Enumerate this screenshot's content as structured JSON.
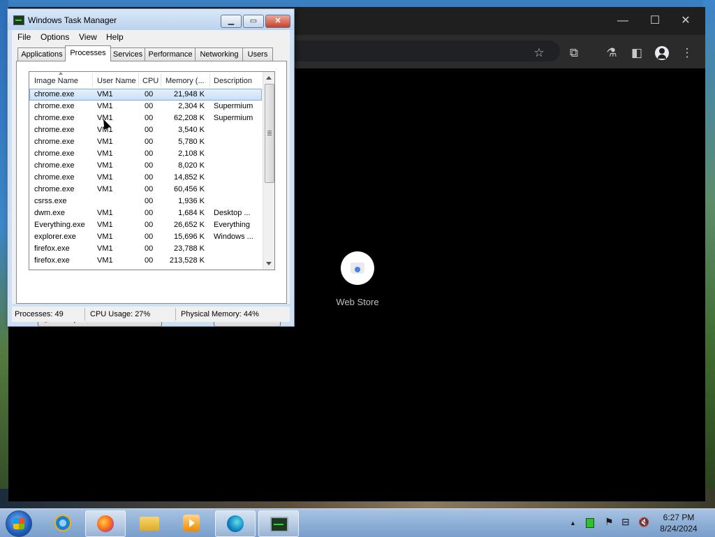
{
  "chrome": {
    "web_store_label": "Web Store",
    "controls": {
      "minimize": "—",
      "maximize": "☐",
      "close": "✕"
    },
    "toolbar_icons": [
      "star-icon",
      "extensions-icon",
      "labs-icon",
      "sidepanel-icon",
      "profile-icon",
      "menu-icon"
    ]
  },
  "task_manager": {
    "title": "Windows Task Manager",
    "window_buttons": {
      "minimize": "▁",
      "maximize": "▭",
      "close": "✕"
    },
    "menu": {
      "file": "File",
      "options": "Options",
      "view": "View",
      "help": "Help"
    },
    "tabs": [
      {
        "label": "Applications"
      },
      {
        "label": "Processes"
      },
      {
        "label": "Services"
      },
      {
        "label": "Performance"
      },
      {
        "label": "Networking"
      },
      {
        "label": "Users"
      }
    ],
    "columns": {
      "image_name": "Image Name",
      "user_name": "User Name",
      "cpu": "CPU",
      "memory": "Memory (...",
      "description": "Description"
    },
    "rows": [
      {
        "name": "chrome.exe",
        "user": "VM1",
        "cpu": "00",
        "memory": "21,948 K",
        "description": ""
      },
      {
        "name": "chrome.exe",
        "user": "VM1",
        "cpu": "00",
        "memory": "2,304 K",
        "description": "Supermium"
      },
      {
        "name": "chrome.exe",
        "user": "VM1",
        "cpu": "00",
        "memory": "62,208 K",
        "description": "Supermium"
      },
      {
        "name": "chrome.exe",
        "user": "VM1",
        "cpu": "00",
        "memory": "3,540 K",
        "description": ""
      },
      {
        "name": "chrome.exe",
        "user": "VM1",
        "cpu": "00",
        "memory": "5,780 K",
        "description": ""
      },
      {
        "name": "chrome.exe",
        "user": "VM1",
        "cpu": "00",
        "memory": "2,108 K",
        "description": ""
      },
      {
        "name": "chrome.exe",
        "user": "VM1",
        "cpu": "00",
        "memory": "8,020 K",
        "description": ""
      },
      {
        "name": "chrome.exe",
        "user": "VM1",
        "cpu": "00",
        "memory": "14,852 K",
        "description": ""
      },
      {
        "name": "chrome.exe",
        "user": "VM1",
        "cpu": "00",
        "memory": "60,456 K",
        "description": ""
      },
      {
        "name": "csrss.exe",
        "user": "",
        "cpu": "00",
        "memory": "1,936 K",
        "description": ""
      },
      {
        "name": "dwm.exe",
        "user": "VM1",
        "cpu": "00",
        "memory": "1,684 K",
        "description": "Desktop ..."
      },
      {
        "name": "Everything.exe",
        "user": "VM1",
        "cpu": "00",
        "memory": "26,652 K",
        "description": "Everything"
      },
      {
        "name": "explorer.exe",
        "user": "VM1",
        "cpu": "00",
        "memory": "15,696 K",
        "description": "Windows ..."
      },
      {
        "name": "firefox.exe",
        "user": "VM1",
        "cpu": "00",
        "memory": "23,788 K",
        "description": ""
      },
      {
        "name": "firefox.exe",
        "user": "VM1",
        "cpu": "00",
        "memory": "213,528 K",
        "description": ""
      }
    ],
    "show_all_button": "Show processes from all users",
    "end_process_button": "End Process",
    "status": {
      "processes": "Processes: 49",
      "cpu": "CPU Usage: 27%",
      "memory": "Physical Memory: 44%"
    }
  },
  "taskbar": {
    "apps": [
      {
        "name": "internet-explorer-icon",
        "open": false
      },
      {
        "name": "firefox-icon",
        "open": true
      },
      {
        "name": "file-explorer-icon",
        "open": false
      },
      {
        "name": "media-player-icon",
        "open": false
      },
      {
        "name": "supermium-icon",
        "open": true
      },
      {
        "name": "task-manager-icon",
        "open": true
      }
    ],
    "tray": {
      "show_hidden": "▲",
      "flag": "⚑",
      "network": "⊟",
      "volume": "🔇"
    },
    "clock": {
      "time": "6:27 PM",
      "date": "8/24/2024"
    }
  }
}
